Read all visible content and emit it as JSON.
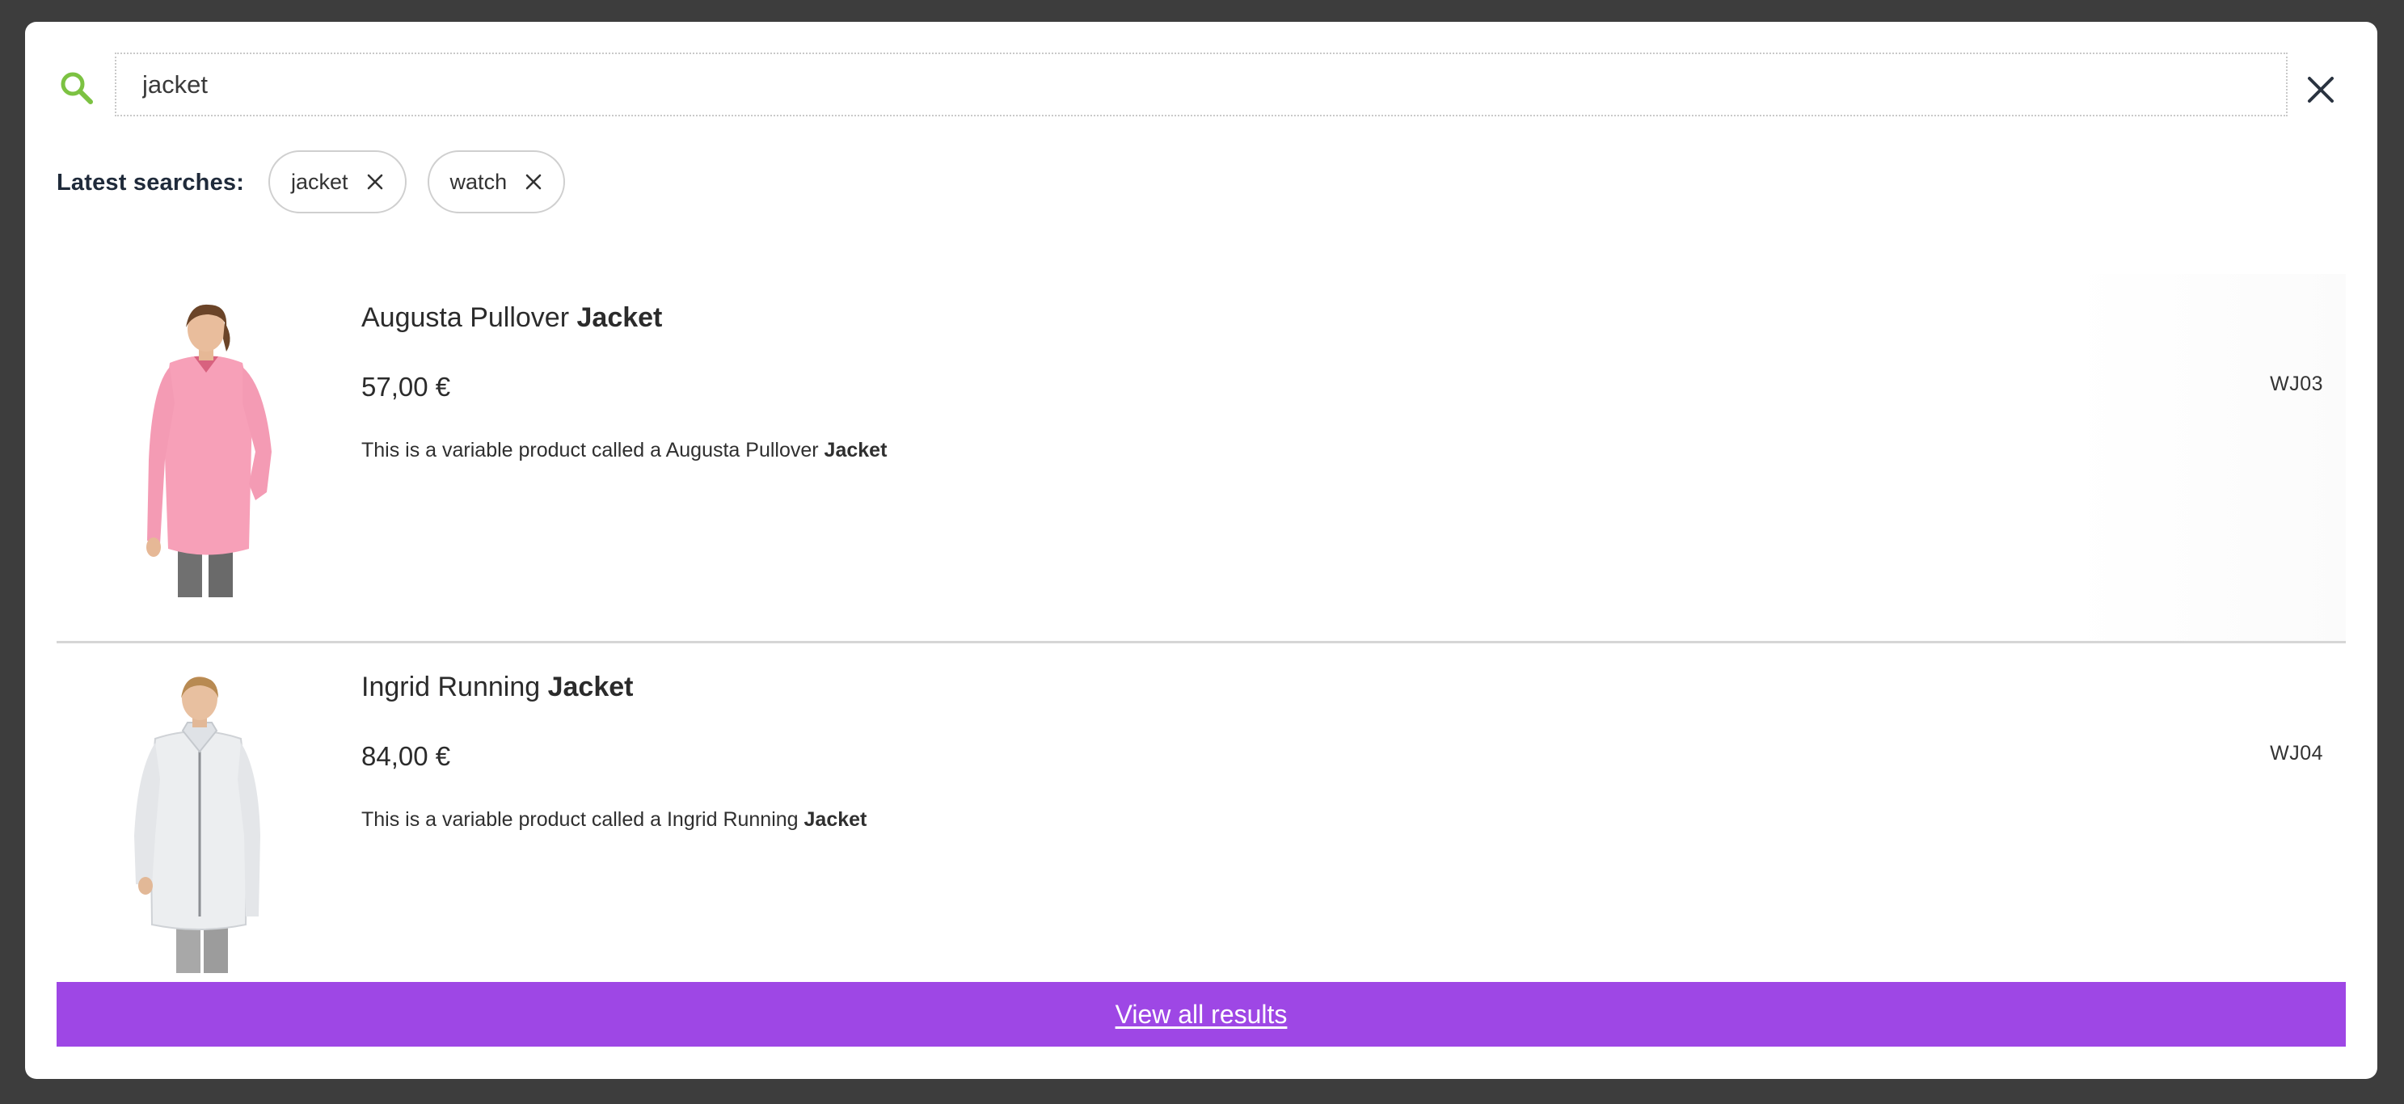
{
  "search": {
    "value": "jacket",
    "icon": "search-icon",
    "close_icon": "close-icon",
    "accent_color": "#7cc242"
  },
  "latest_searches": {
    "label": "Latest searches:",
    "chips": [
      {
        "label": "jacket",
        "remove_icon": "x-icon"
      },
      {
        "label": "watch",
        "remove_icon": "x-icon"
      }
    ]
  },
  "results": [
    {
      "title_prefix": "Augusta Pullover",
      "title_match": "Jacket",
      "price": "57,00 €",
      "description_prefix": "This is a variable product called a Augusta Pullover",
      "description_match": "Jacket",
      "sku": "WJ03",
      "image": "pink-pullover-jacket-photo"
    },
    {
      "title_prefix": "Ingrid Running",
      "title_match": "Jacket",
      "price": "84,00 €",
      "description_prefix": "This is a variable product called a Ingrid Running",
      "description_match": "Jacket",
      "sku": "WJ04",
      "image": "white-running-jacket-photo"
    }
  ],
  "view_all": {
    "label": "View all results",
    "color": "#9e47e5"
  }
}
